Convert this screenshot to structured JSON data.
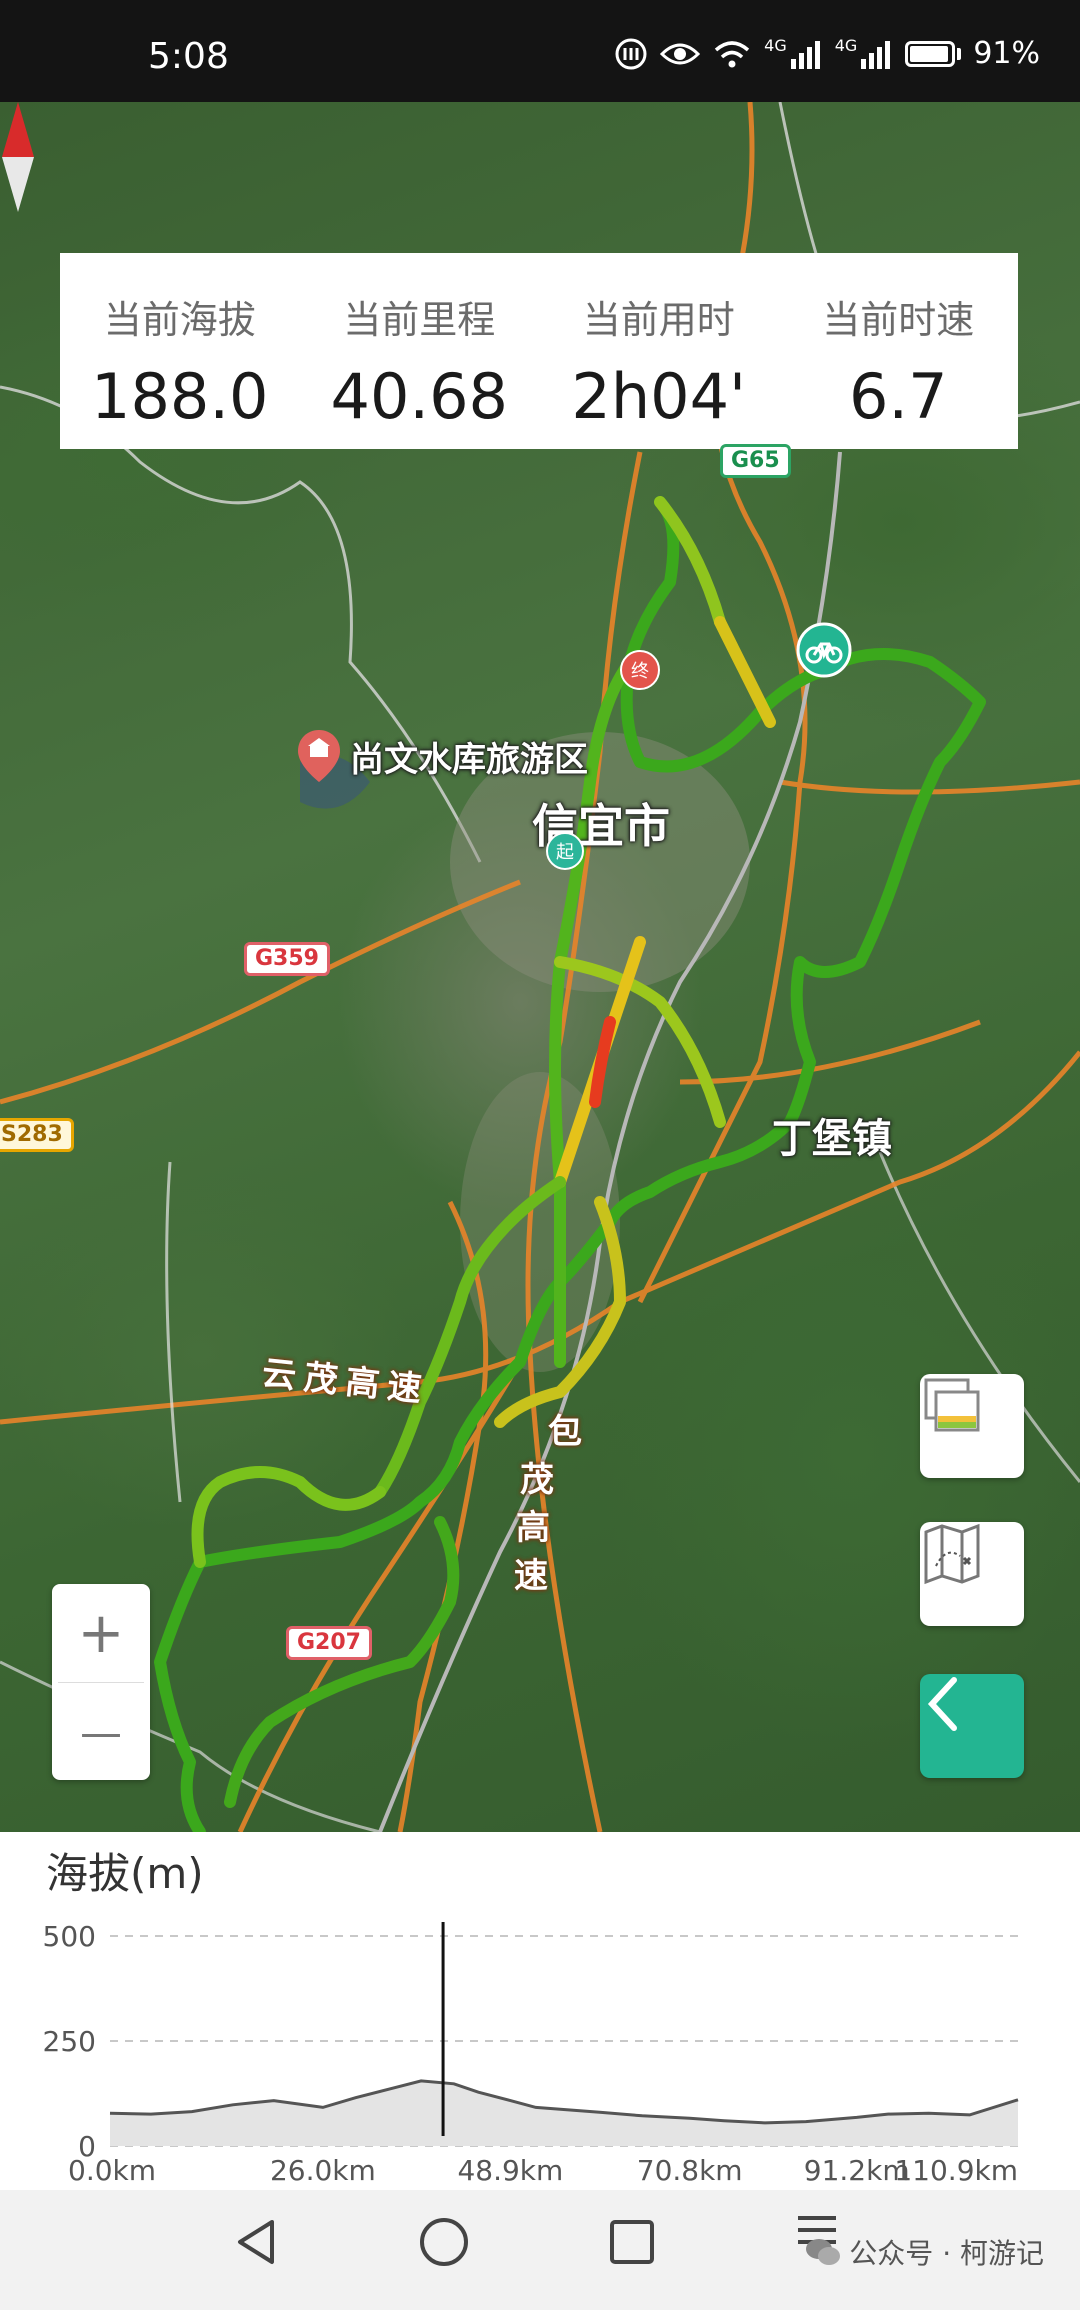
{
  "status_bar": {
    "time": "5:08",
    "icons": [
      "nfc-icon",
      "eye-icon",
      "wifi-icon",
      "signal-4g-icon",
      "signal-4g-icon",
      "battery-icon"
    ],
    "net1": "4G",
    "net2": "4G",
    "battery": "91%"
  },
  "stats": [
    {
      "label": "当前海拔",
      "value": "188.0"
    },
    {
      "label": "当前里程",
      "value": "40.68"
    },
    {
      "label": "当前用时",
      "value": "2h04'"
    },
    {
      "label": "当前时速",
      "value": "6.7"
    }
  ],
  "map": {
    "labels": {
      "reservoir": "尚文水库旅游区",
      "city": "信宜市",
      "town": "丁堡镇",
      "expressway1": "云茂高速",
      "expressway2_chars": [
        "包",
        "茂",
        "高",
        "速"
      ]
    },
    "road_shields": {
      "g65": "G65",
      "g359": "G359",
      "s283": "S283",
      "g207": "G207"
    },
    "markers": {
      "start": "起",
      "end": "终"
    },
    "track_colors": {
      "slow": "#e63b1f",
      "medium": "#e5c21a",
      "fast": "#3aa11c"
    }
  },
  "controls": {
    "zoom_in": "+",
    "zoom_out": "—"
  },
  "elevation_chart": {
    "title": "海拔(m)",
    "chart_data": {
      "type": "area",
      "xlabel": "",
      "ylabel": "海拔(m)",
      "yticks": [
        "500",
        "250",
        "0"
      ],
      "ylim": [
        0,
        500
      ],
      "xlim": [
        0,
        110.9
      ],
      "xtick_labels": [
        "0.0km",
        "26.0km",
        "48.9km",
        "70.8km",
        "91.2km",
        "110.9km"
      ],
      "x": [
        0,
        5,
        10,
        15,
        20,
        26,
        30,
        35,
        38,
        42,
        45,
        48.9,
        52,
        56,
        60,
        65,
        70.8,
        75,
        80,
        85,
        91.2,
        95,
        100,
        105,
        110.9
      ],
      "y": [
        78,
        76,
        82,
        98,
        108,
        92,
        115,
        140,
        155,
        148,
        128,
        108,
        92,
        86,
        80,
        72,
        66,
        60,
        55,
        58,
        68,
        76,
        78,
        74,
        110
      ],
      "cursor_x": 40.68
    }
  },
  "watermark": "公众号 · 柯游记"
}
